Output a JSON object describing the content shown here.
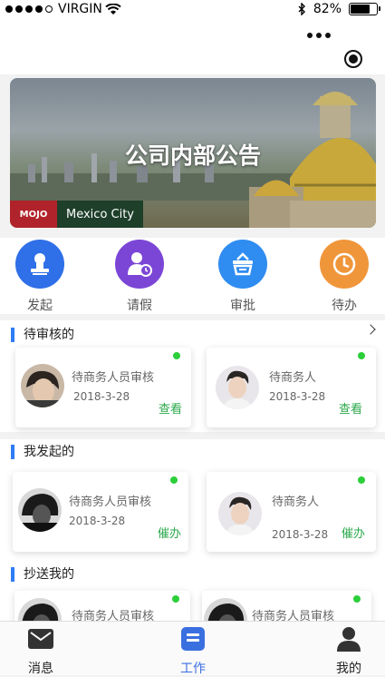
{
  "status_bar": {
    "carrier": "VIRGIN",
    "battery": "82%",
    "battery_level": 0.82
  },
  "banner": {
    "title": "公司内部公告",
    "logo_text": "MOJO",
    "city_label": "Mexico City"
  },
  "quick_actions": [
    {
      "label": "发起",
      "icon": "person-stamp-icon",
      "color": "#2f6fe8"
    },
    {
      "label": "请假",
      "icon": "person-clock-icon",
      "color": "#7b46d6"
    },
    {
      "label": "审批",
      "icon": "basket-icon",
      "color": "#2f8cf0"
    },
    {
      "label": "待办",
      "icon": "clock-icon",
      "color": "#f0963a"
    }
  ],
  "sections": {
    "pending": {
      "title": "待审核的",
      "cards": [
        {
          "name": "待商务人员审核",
          "date": "2018-3-28",
          "action": "查看"
        },
        {
          "name": "待商务人",
          "date": "2018-3-28",
          "action": "查看"
        }
      ]
    },
    "initiated": {
      "title": "我发起的",
      "cards": [
        {
          "name": "待商务人员审核",
          "date": "2018-3-28",
          "action": "催办"
        },
        {
          "name": "待商务人",
          "date": "2018-3-28",
          "action": "催办"
        }
      ]
    },
    "cc": {
      "title": "抄送我的",
      "cards": [
        {
          "name": "待商务人员审核"
        },
        {
          "name": "待商务人员审核"
        }
      ]
    }
  },
  "colors": {
    "accent": "#2f7cf6",
    "green_action": "#2aa84a",
    "status_dot": "#2ccf3a"
  },
  "tabbar": [
    {
      "label": "消息",
      "icon": "message-icon"
    },
    {
      "label": "工作",
      "icon": "work-icon",
      "active": true
    },
    {
      "label": "我的",
      "icon": "profile-icon"
    }
  ]
}
